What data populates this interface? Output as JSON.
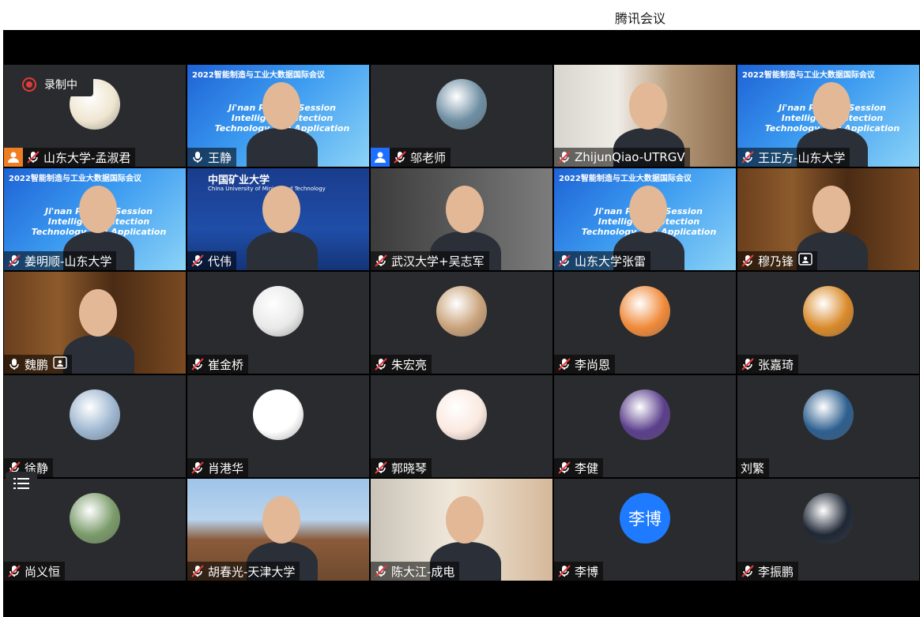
{
  "app": {
    "title": "腾讯会议"
  },
  "recording": {
    "label": "录制中"
  },
  "colors": {
    "accent": "#1e7bff",
    "host": "#ef7d22",
    "tile": "#2a2b2e"
  },
  "participants": [
    {
      "name": "山东大学-孟淑君",
      "mic": "muted",
      "badge": "host",
      "view": "avatar"
    },
    {
      "name": "王静",
      "mic": "on",
      "view": "video"
    },
    {
      "name": "邬老师",
      "mic": "muted",
      "badge": "cohost",
      "view": "avatar"
    },
    {
      "name": "ZhijunQiao-UTRGV",
      "mic": "muted",
      "view": "video"
    },
    {
      "name": "王正方-山东大学",
      "mic": "muted",
      "view": "video"
    },
    {
      "name": "姜明顺-山东大学",
      "mic": "muted",
      "view": "video"
    },
    {
      "name": "代伟",
      "mic": "muted",
      "view": "video"
    },
    {
      "name": "武汉大学+吴志军",
      "mic": "muted",
      "view": "video"
    },
    {
      "name": "山东大学张雷",
      "mic": "muted",
      "view": "video"
    },
    {
      "name": "穆乃锋",
      "mic": "muted",
      "view": "video",
      "sharing": true
    },
    {
      "name": "魏鹏",
      "mic": "on",
      "view": "video",
      "sharing": true
    },
    {
      "name": "崔金桥",
      "mic": "muted",
      "view": "avatar"
    },
    {
      "name": "朱宏亮",
      "mic": "muted",
      "view": "avatar"
    },
    {
      "name": "李尚恩",
      "mic": "muted",
      "view": "avatar"
    },
    {
      "name": "张嘉琦",
      "mic": "muted",
      "view": "avatar"
    },
    {
      "name": "徐静",
      "mic": "muted",
      "view": "avatar"
    },
    {
      "name": "肖港华",
      "mic": "muted",
      "view": "avatar"
    },
    {
      "name": "郭晓琴",
      "mic": "muted",
      "view": "avatar"
    },
    {
      "name": "李健",
      "mic": "muted",
      "view": "avatar"
    },
    {
      "name": "刘繁",
      "mic": "none",
      "view": "avatar"
    },
    {
      "name": "尚义恒",
      "mic": "muted",
      "view": "avatar"
    },
    {
      "name": "胡春光-天津大学",
      "mic": "muted",
      "view": "video"
    },
    {
      "name": "陈大江-成电",
      "mic": "muted",
      "view": "video"
    },
    {
      "name": "李博",
      "mic": "muted",
      "view": "text-avatar",
      "avatar_text": "李博"
    },
    {
      "name": "李振鹏",
      "mic": "muted",
      "view": "avatar"
    }
  ],
  "slides": {
    "conf_title": "2022智能制造与工业大数据国际会议",
    "session_1": "Ji'nan Parallel Session",
    "session_2": "Intelligent Detection Technology and Application",
    "cumt_name": "中国矿业大学",
    "cumt_en": "China University of Mining and Technology"
  }
}
